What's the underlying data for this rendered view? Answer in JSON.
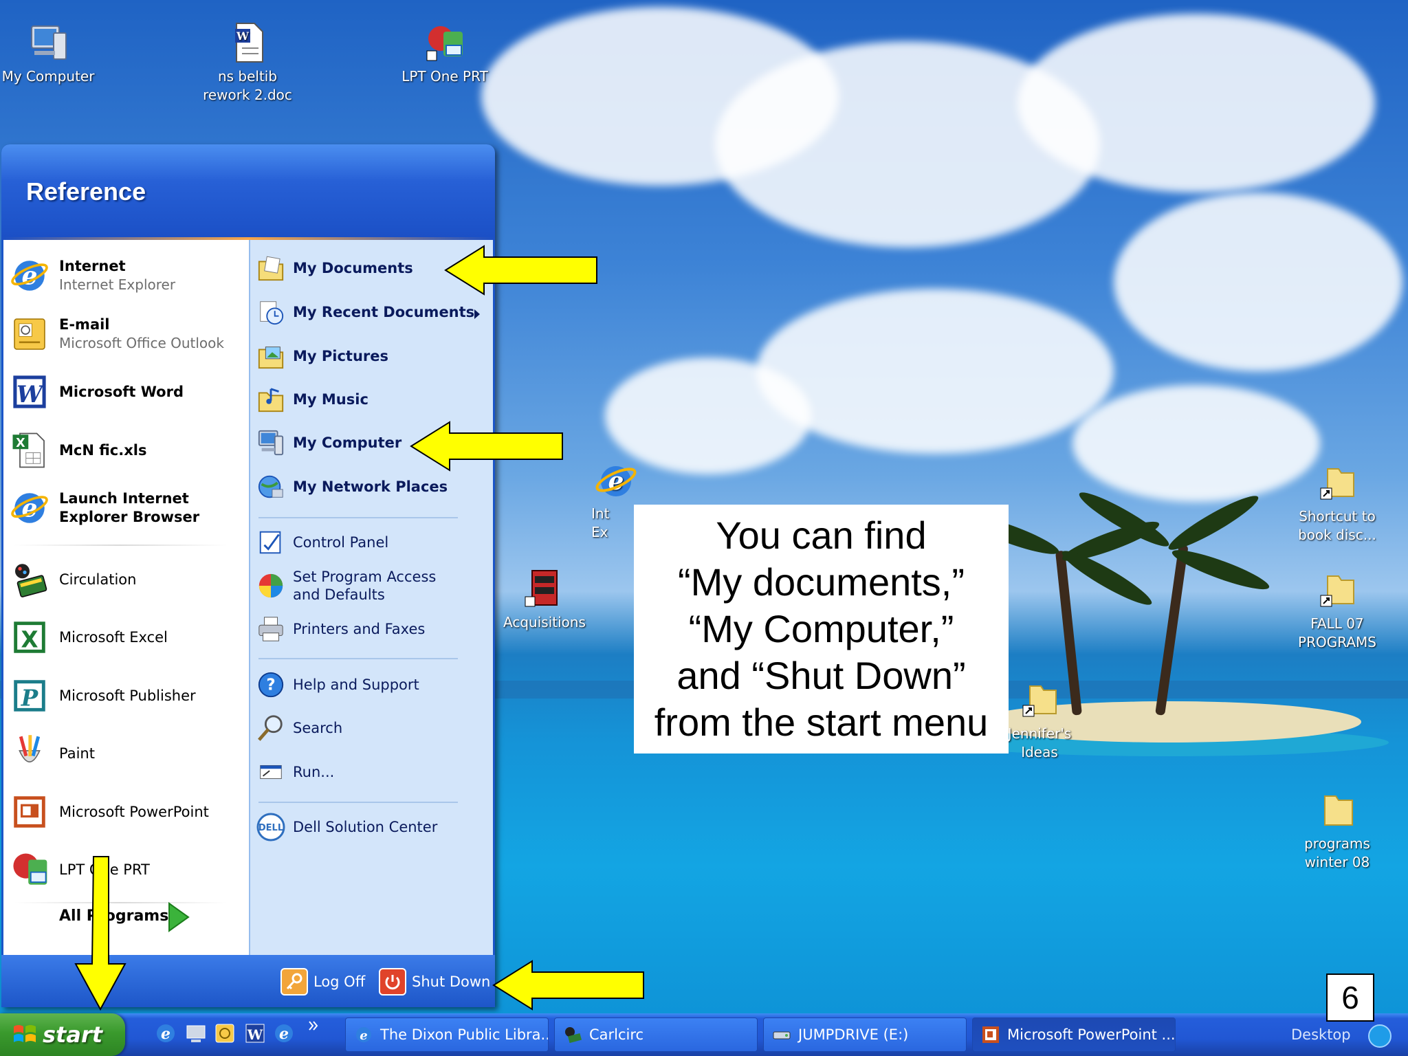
{
  "desktop": {
    "icons": [
      {
        "label": "My Computer",
        "icon": "my-computer-icon"
      },
      {
        "label": "ns beltib rework 2.doc",
        "icon": "word-document-icon"
      },
      {
        "label": "LPT One PRT",
        "icon": "lpt-one-prt-icon"
      },
      {
        "label": "Acquisitions",
        "icon": "acquisitions-icon"
      },
      {
        "label": "Int Ex",
        "icon": "internet-explorer-icon"
      },
      {
        "label": "Shortcut to book disc...",
        "icon": "folder-shortcut-icon"
      },
      {
        "label": "FALL 07 PROGRAMS",
        "icon": "folder-shortcut-icon"
      },
      {
        "label": "Jennifer's Ideas",
        "icon": "folder-shortcut-icon"
      },
      {
        "label": "programs winter 08",
        "icon": "folder-icon"
      }
    ]
  },
  "start_menu": {
    "user": "Reference",
    "pinned": [
      {
        "title": "Internet",
        "subtitle": "Internet Explorer",
        "icon": "internet-explorer-icon"
      },
      {
        "title": "E-mail",
        "subtitle": "Microsoft Office Outlook",
        "icon": "outlook-icon"
      }
    ],
    "programs": [
      {
        "label": "Microsoft Word",
        "icon": "word-icon",
        "bold": true
      },
      {
        "label": "McN fic.xls",
        "icon": "excel-file-icon",
        "bold": true
      },
      {
        "label": "Launch Internet Explorer Browser",
        "icon": "internet-explorer-icon",
        "bold": true
      },
      {
        "label": "Circulation",
        "icon": "circulation-icon"
      },
      {
        "label": "Microsoft Excel",
        "icon": "excel-icon"
      },
      {
        "label": "Microsoft Publisher",
        "icon": "publisher-icon"
      },
      {
        "label": "Paint",
        "icon": "paint-icon"
      },
      {
        "label": "Microsoft PowerPoint",
        "icon": "powerpoint-icon"
      },
      {
        "label": "LPT One PRT",
        "icon": "lpt-one-prt-icon"
      }
    ],
    "all_programs": "All Programs",
    "places": [
      {
        "label": "My Documents",
        "icon": "my-documents-icon"
      },
      {
        "label": "My Recent Documents",
        "icon": "recent-documents-icon"
      },
      {
        "label": "My Pictures",
        "icon": "my-pictures-icon"
      },
      {
        "label": "My Music",
        "icon": "my-music-icon"
      },
      {
        "label": "My Computer",
        "icon": "my-computer-icon"
      },
      {
        "label": "My Network Places",
        "icon": "network-places-icon"
      }
    ],
    "settings": [
      {
        "label": "Control Panel",
        "icon": "control-panel-icon"
      },
      {
        "label": "Set Program Access and Defaults",
        "icon": "program-access-icon"
      },
      {
        "label": "Printers and Faxes",
        "icon": "printer-icon"
      }
    ],
    "tools": [
      {
        "label": "Help and Support",
        "icon": "help-icon"
      },
      {
        "label": "Search",
        "icon": "search-icon"
      },
      {
        "label": "Run...",
        "icon": "run-icon"
      }
    ],
    "oem": {
      "label": "Dell Solution Center",
      "icon": "dell-icon"
    },
    "log_off": "Log Off",
    "shut_down": "Shut Down"
  },
  "annotation": {
    "lines": [
      "You can find",
      "“My documents,”",
      "“My Computer,”",
      "and “Shut Down”",
      "from the start menu"
    ]
  },
  "slide_number": "6",
  "taskbar": {
    "start_label": "start",
    "quick_launch": [
      "internet-explorer-icon",
      "desktop-icon",
      "outlook-icon",
      "word-icon",
      "internet-explorer-icon"
    ],
    "tasks": [
      {
        "label": "The Dixon Public Libra...",
        "icon": "internet-explorer-icon"
      },
      {
        "label": "Carlcirc",
        "icon": "carlcirc-icon"
      },
      {
        "label": "JUMPDRIVE (E:)",
        "icon": "drive-icon"
      },
      {
        "label": "Microsoft PowerPoint ...",
        "icon": "powerpoint-icon"
      }
    ],
    "toolbar_label": "Desktop"
  },
  "colors": {
    "arrow": "#ffff00",
    "start_green": "#3a9a2d",
    "taskbar_blue": "#2157d4",
    "menu_right_pane": "#d3e5fa"
  }
}
